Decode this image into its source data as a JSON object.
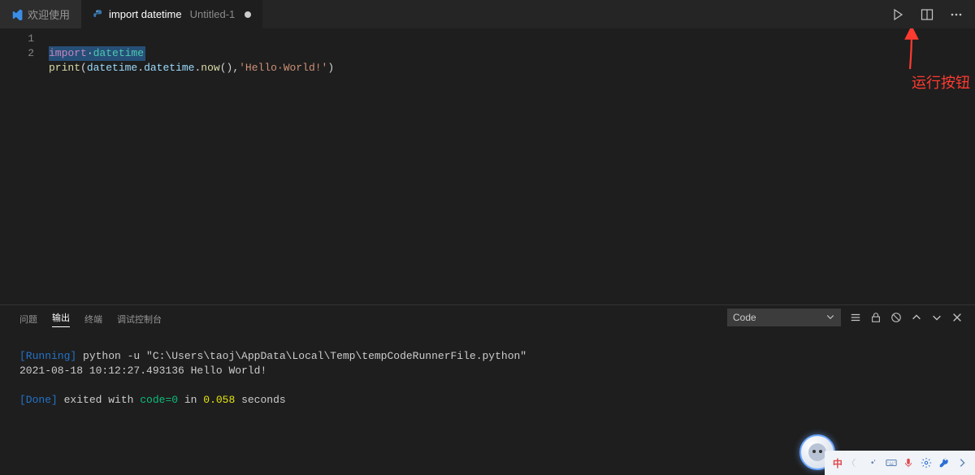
{
  "tabs": {
    "welcome": {
      "label": "欢迎使用"
    },
    "active": {
      "prefix": "import datetime",
      "filename": "Untitled-1"
    }
  },
  "editor": {
    "lines": [
      "1",
      "2"
    ],
    "line1": {
      "import": "import",
      "sep": "·",
      "mod": "datetime"
    },
    "line2": {
      "func": "print",
      "open": "(",
      "mod1": "datetime",
      "dot1": ".",
      "mod2": "datetime",
      "dot2": ".",
      "now": "now",
      "parens": "()",
      "comma": ",",
      "str": "'Hello·World!'",
      "close": ")"
    }
  },
  "panel": {
    "tabs": {
      "problems": "问题",
      "output": "输出",
      "terminal": "终端",
      "debug": "调试控制台"
    },
    "select": "Code",
    "output": {
      "running_tag": "[Running]",
      "running_cmd": " python -u \"C:\\Users\\taoj\\AppData\\Local\\Temp\\tempCodeRunnerFile.python\"",
      "line2": "2021-08-18 10:12:27.493136 Hello World!",
      "done_tag": "[Done]",
      "done_pre": " exited with ",
      "done_code": "code=0",
      "done_mid": " in ",
      "done_time": "0.058",
      "done_post": " seconds"
    }
  },
  "annotation": {
    "label": "运行按钮"
  },
  "taskbar": {
    "ime": "中"
  }
}
